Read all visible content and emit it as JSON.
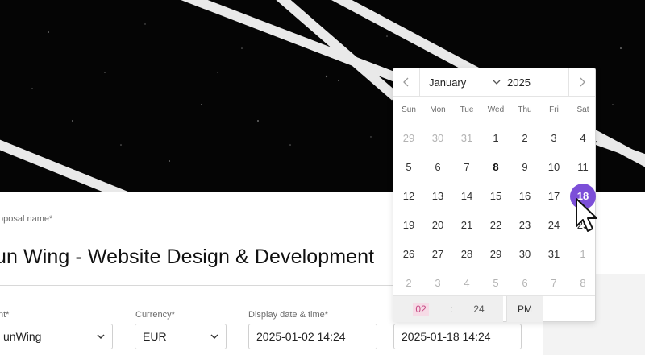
{
  "form": {
    "proposal_name_label": "oposal name*",
    "proposal_name_value": "un Wing - Website Design & Development",
    "client_label": "nt*",
    "client_value": "unWing",
    "currency_label": "Currency*",
    "currency_value": "EUR",
    "display_date_label": "Display date & time*",
    "display_date_value": "2025-01-02 14:24",
    "expiry_date_value": "2025-01-18 14:24"
  },
  "calendar": {
    "month": "January",
    "year": "2025",
    "weekdays": [
      "Sun",
      "Mon",
      "Tue",
      "Wed",
      "Thu",
      "Fri",
      "Sat"
    ],
    "weeks": [
      [
        "29",
        "30",
        "31",
        "1",
        "2",
        "3",
        "4"
      ],
      [
        "5",
        "6",
        "7",
        "8",
        "9",
        "10",
        "11"
      ],
      [
        "12",
        "13",
        "14",
        "15",
        "16",
        "17",
        "18"
      ],
      [
        "19",
        "20",
        "21",
        "22",
        "23",
        "24",
        "25"
      ],
      [
        "26",
        "27",
        "28",
        "29",
        "30",
        "31",
        "1"
      ],
      [
        "2",
        "3",
        "4",
        "5",
        "6",
        "7",
        "8"
      ]
    ],
    "today": "8",
    "selected": "18",
    "selected_color": "#7c4fd8",
    "time": {
      "hour": "02",
      "separator": ":",
      "minute": "24",
      "ampm": "PM"
    }
  }
}
